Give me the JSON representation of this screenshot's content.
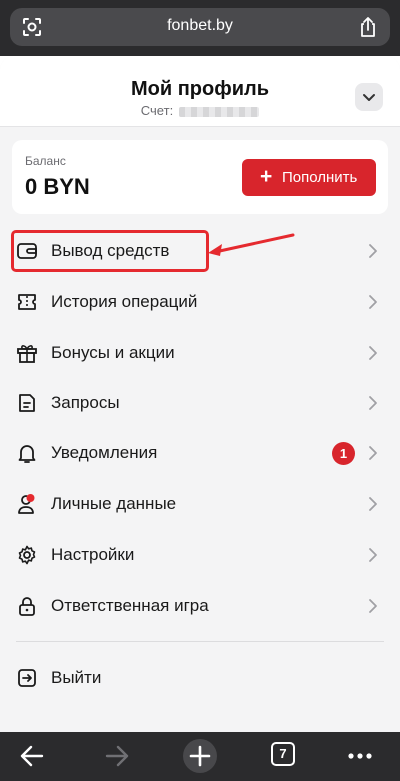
{
  "browser": {
    "url": "fonbet.by",
    "tabs_count": "7"
  },
  "header": {
    "title": "Мой профиль",
    "account_label": "Счет:"
  },
  "balance": {
    "label": "Баланс",
    "value": "0 BYN",
    "topup_label": "Пополнить"
  },
  "menu": {
    "items": [
      {
        "label": "Вывод средств",
        "icon": "wallet-icon"
      },
      {
        "label": "История операций",
        "icon": "ticket-icon"
      },
      {
        "label": "Бонусы и акции",
        "icon": "gift-icon"
      },
      {
        "label": "Запросы",
        "icon": "document-icon"
      },
      {
        "label": "Уведомления",
        "icon": "bell-icon",
        "badge": "1"
      },
      {
        "label": "Личные данные",
        "icon": "user-icon"
      },
      {
        "label": "Настройки",
        "icon": "gear-icon"
      },
      {
        "label": "Ответственная игра",
        "icon": "lock-icon"
      }
    ],
    "logout_label": "Выйти"
  },
  "colors": {
    "accent": "#d8252c",
    "annotation": "#e52a2f",
    "page_bg": "#f4f4f5",
    "browser_bg": "#2b2b2d"
  }
}
